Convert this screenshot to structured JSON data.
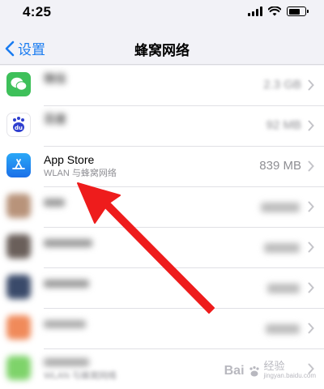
{
  "status_bar": {
    "time": "4:25",
    "signal_bars": 4,
    "battery_level": 0.7
  },
  "nav": {
    "back_label": "设置",
    "title": "蜂窝网络"
  },
  "apps": [
    {
      "name": "微信",
      "subtitle": "",
      "size": "2.3 GB",
      "icon": "wechat-icon",
      "color": "#3ec05a",
      "obscured": true
    },
    {
      "name": "百度",
      "subtitle": "",
      "size": "92 MB",
      "icon": "baidu-icon",
      "color": "#2f6ef0",
      "obscured": true
    },
    {
      "name": "App Store",
      "subtitle": "WLAN 与蜂窝网络",
      "size": "839 MB",
      "icon": "app-store-icon",
      "color": "#1f8ef5",
      "obscured": false
    },
    {
      "name": "",
      "subtitle": "",
      "size": "",
      "icon": "app-icon",
      "color": "#b8937a",
      "obscured": true
    },
    {
      "name": "",
      "subtitle": "",
      "size": "",
      "icon": "app-icon",
      "color": "#6a5f5a",
      "obscured": true
    },
    {
      "name": "",
      "subtitle": "",
      "size": "",
      "icon": "app-icon",
      "color": "#3a4a6a",
      "obscured": true
    },
    {
      "name": "",
      "subtitle": "",
      "size": "",
      "icon": "app-icon",
      "color": "#f08a5a",
      "obscured": true
    },
    {
      "name": "",
      "subtitle": "WLAN 与蜂窝网络",
      "size": "",
      "icon": "app-icon",
      "color": "#7ed36a",
      "obscured": true
    }
  ],
  "watermark": {
    "brand": "Bai",
    "brand2": "经验",
    "url": "jingyan.baidu.com"
  },
  "colors": {
    "accent": "#1a7cf0",
    "arrow": "#ee1c1c"
  }
}
